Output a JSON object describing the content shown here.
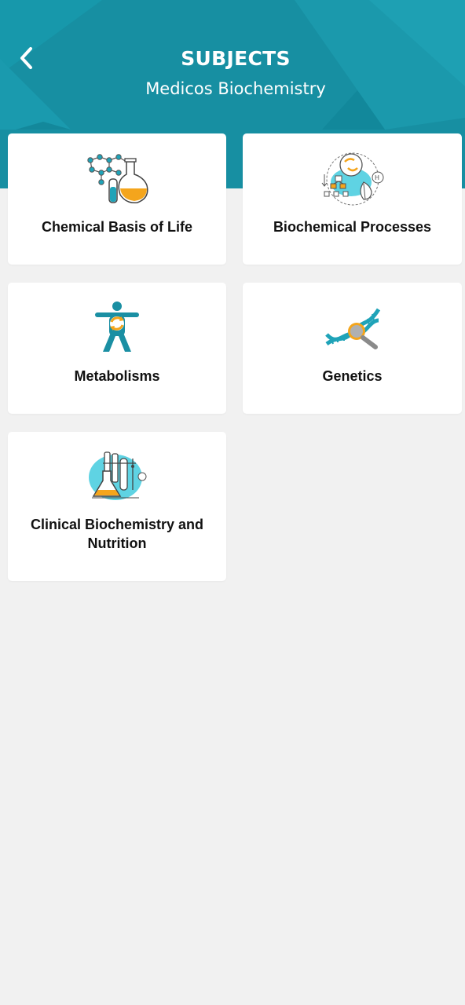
{
  "header": {
    "title": "SUBJECTS",
    "subtitle": "Medicos Biochemistry",
    "background_color": "#178fa2",
    "back_icon": "chevron-left-icon"
  },
  "subjects": [
    {
      "label": "Chemical Basis of Life",
      "icon": "molecule-flask-icon"
    },
    {
      "label": "Biochemical Processes",
      "icon": "biochemical-process-icon"
    },
    {
      "label": "Metabolisms",
      "icon": "human-metabolism-icon"
    },
    {
      "label": "Genetics",
      "icon": "dna-magnifier-icon"
    },
    {
      "label": "Clinical Biochemistry and Nutrition",
      "icon": "lab-glassware-icon"
    }
  ],
  "colors": {
    "accent_teal": "#1fa3b8",
    "orange": "#f4a51c",
    "card_background": "#ffffff",
    "page_background": "#f1f1f1"
  }
}
